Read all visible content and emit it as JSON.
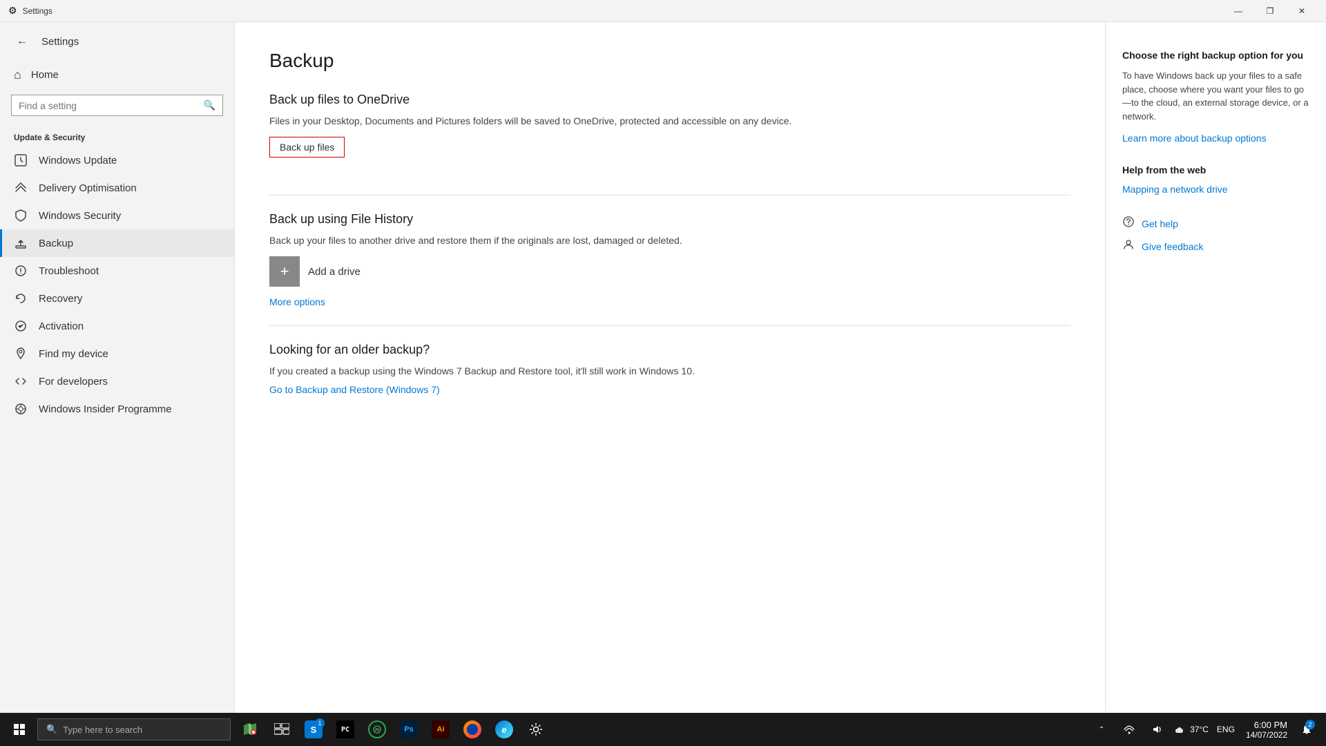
{
  "titlebar": {
    "title": "Settings",
    "min_label": "—",
    "restore_label": "❐",
    "close_label": "✕"
  },
  "sidebar": {
    "back_title": "Settings",
    "home_label": "Home",
    "search_placeholder": "Find a setting",
    "section_label": "Update & Security",
    "nav_items": [
      {
        "id": "windows-update",
        "label": "Windows Update",
        "icon": "↻"
      },
      {
        "id": "delivery-optimisation",
        "label": "Delivery Optimisation",
        "icon": "⬇"
      },
      {
        "id": "windows-security",
        "label": "Windows Security",
        "icon": "🛡"
      },
      {
        "id": "backup",
        "label": "Backup",
        "icon": "↑",
        "active": true
      },
      {
        "id": "troubleshoot",
        "label": "Troubleshoot",
        "icon": "⚙"
      },
      {
        "id": "recovery",
        "label": "Recovery",
        "icon": "↩"
      },
      {
        "id": "activation",
        "label": "Activation",
        "icon": "✓"
      },
      {
        "id": "find-my-device",
        "label": "Find my device",
        "icon": "📍"
      },
      {
        "id": "for-developers",
        "label": "For developers",
        "icon": "⌨"
      },
      {
        "id": "windows-insider",
        "label": "Windows Insider Programme",
        "icon": "⊕"
      }
    ]
  },
  "main": {
    "page_title": "Backup",
    "onedrive_section": {
      "title": "Back up files to OneDrive",
      "description": "Files in your Desktop, Documents and Pictures folders will be saved to OneDrive, protected and accessible on any device.",
      "button_label": "Back up files"
    },
    "file_history_section": {
      "title": "Back up using File History",
      "description": "Back up your files to another drive and restore them if the originals are lost, damaged or deleted.",
      "add_drive_label": "Add a drive",
      "more_options_label": "More options"
    },
    "older_backup_section": {
      "title": "Looking for an older backup?",
      "description": "If you created a backup using the Windows 7 Backup and Restore tool, it'll still work in Windows 10.",
      "link_label": "Go to Backup and Restore (Windows 7)"
    }
  },
  "right_panel": {
    "main_section": {
      "title": "Choose the right backup option for you",
      "description": "To have Windows back up your files to a safe place, choose where you want your files to go—to the cloud, an external storage device, or a network.",
      "link_label": "Learn more about backup options"
    },
    "web_section": {
      "title": "Help from the web",
      "link_label": "Mapping a network drive"
    },
    "help_items": [
      {
        "id": "get-help",
        "icon": "💬",
        "label": "Get help"
      },
      {
        "id": "give-feedback",
        "icon": "👤",
        "label": "Give feedback"
      }
    ]
  },
  "taskbar": {
    "search_placeholder": "Type here to search",
    "apps": [
      {
        "id": "maps",
        "color": "#4caf50",
        "label": "Maps"
      },
      {
        "id": "task-view",
        "label": "⊞"
      },
      {
        "id": "store",
        "color": "#0078d4",
        "label": "S"
      },
      {
        "id": "jetbrains",
        "color": "#f57c00",
        "label": "PC"
      },
      {
        "id": "terminal",
        "color": "#2ea44f",
        "label": "◯"
      },
      {
        "id": "photoshop",
        "color": "#31a8ff",
        "label": "Ps"
      },
      {
        "id": "chrome",
        "label": "Ai"
      },
      {
        "id": "firefox",
        "label": "🦊"
      },
      {
        "id": "edge",
        "label": "e"
      },
      {
        "id": "settings-tb",
        "label": "⚙"
      }
    ],
    "system_tray": {
      "weather": "37°C",
      "eng": "ENG",
      "time": "6:00 PM",
      "date": "14/07/2022"
    },
    "notification_count": "2"
  }
}
